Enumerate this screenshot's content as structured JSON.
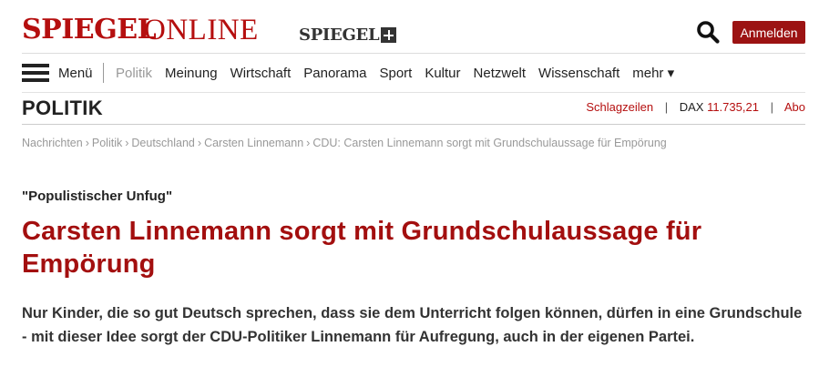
{
  "header": {
    "logo_spiegel": "SPIEGEL",
    "logo_online": "ONLINE",
    "logo_plus": "SPIEGEL",
    "login_label": "Anmelden",
    "accent_color": "#9c1313"
  },
  "nav": {
    "menu_label": "Menü",
    "items": [
      {
        "label": "Politik",
        "active": true
      },
      {
        "label": "Meinung"
      },
      {
        "label": "Wirtschaft"
      },
      {
        "label": "Panorama"
      },
      {
        "label": "Sport"
      },
      {
        "label": "Kultur"
      },
      {
        "label": "Netzwelt"
      },
      {
        "label": "Wissenschaft"
      }
    ],
    "more_label": "mehr ▾"
  },
  "section": {
    "title": "POLITIK",
    "headlines_link": "Schlagzeilen",
    "dax_label": "DAX",
    "dax_value": "11.735,21",
    "abo_link": "Abo"
  },
  "breadcrumb": [
    "Nachrichten",
    "Politik",
    "Deutschland",
    "Carsten Linnemann",
    "CDU: Carsten Linnemann sorgt mit Grundschulaussage für Empörung"
  ],
  "breadcrumb_separator": "›",
  "article": {
    "kicker": "\"Populistischer Unfug\"",
    "headline": "Carsten Linnemann sorgt mit Grundschulaussage für Empörung",
    "intro": "Nur Kinder, die so gut Deutsch sprechen, dass sie dem Unterricht folgen können, dürfen in eine Grundschule - mit dieser Idee sorgt der CDU-Politiker Linnemann für Aufregung, auch in der eigenen Partei."
  },
  "icons": {
    "search": "search-icon",
    "menu": "hamburger-menu-icon",
    "plus": "plus-icon"
  }
}
